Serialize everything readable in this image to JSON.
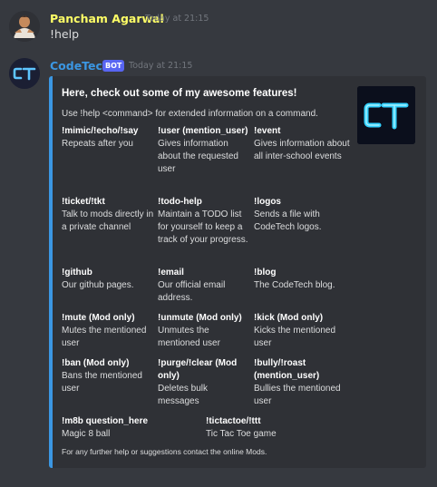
{
  "messages": [
    {
      "author": "Pancham Agarwal",
      "author_color": "#ffff66",
      "timestamp": "Today at 21:15",
      "text": "!help"
    },
    {
      "author": "CodeTech",
      "author_color": "#3b97e3",
      "bot_tag": "BOT",
      "timestamp": "Today at 21:15"
    }
  ],
  "embed": {
    "accent_color": "#3b97e3",
    "title": "Here, check out some of my awesome features!",
    "description": "Use !help <command> for extended information on a command.",
    "fields": [
      {
        "name": "!mimic/!echo/!say",
        "value": "Repeats after you"
      },
      {
        "name": "!user (mention_user)",
        "value": "Gives information about the requested user"
      },
      {
        "name": "!event",
        "value": "Gives information about all inter-school events"
      },
      {
        "name": "!ticket/!tkt",
        "value": "Talk to mods directly in a private channel"
      },
      {
        "name": "!todo-help",
        "value": "Maintain a TODO list for yourself to keep a track of your progress."
      },
      {
        "name": "!logos",
        "value": "Sends a file with CodeTech logos."
      },
      {
        "name": "!github",
        "value": "Our github pages."
      },
      {
        "name": "!email",
        "value": "Our official email address."
      },
      {
        "name": "!blog",
        "value": "The CodeTech blog."
      },
      {
        "name": "!mute (Mod only)",
        "value": "Mutes the mentioned user"
      },
      {
        "name": "!unmute (Mod only)",
        "value": "Unmutes the mentioned user"
      },
      {
        "name": "!kick (Mod only)",
        "value": "Kicks the mentioned user"
      },
      {
        "name": "!ban (Mod only)",
        "value": "Bans the mentioned user"
      },
      {
        "name": "!purge/!clear (Mod only)",
        "value": "Deletes bulk messages"
      },
      {
        "name": "!bully/!roast (mention_user)",
        "value": "Bullies the mentioned user"
      },
      {
        "name": "!m8b question_here",
        "value": "Magic 8 ball"
      },
      {
        "name": "!tictactoe/!ttt",
        "value": "Tic Tac Toe game"
      }
    ],
    "footer": "For any further help or suggestions contact the online Mods."
  }
}
